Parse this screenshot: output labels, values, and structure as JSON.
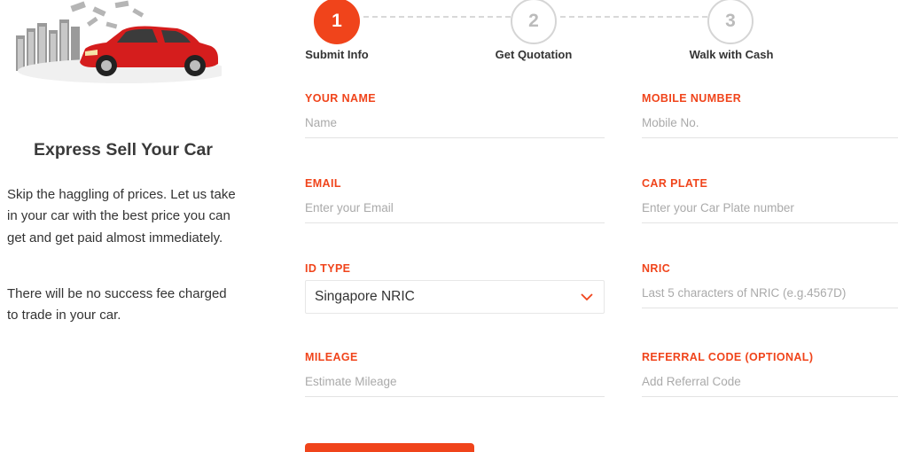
{
  "left_panel": {
    "title": "Express Sell Your Car",
    "paragraph_1": "Skip the haggling of prices. Let us take in your car with the best price you can get and get paid almost immediately.",
    "paragraph_2": "There will be no success fee charged to trade in your car."
  },
  "stepper": {
    "steps": [
      {
        "number": "1",
        "label": "Submit Info",
        "state": "active"
      },
      {
        "number": "2",
        "label": "Get Quotation",
        "state": "inactive"
      },
      {
        "number": "3",
        "label": "Walk with Cash",
        "state": "inactive"
      }
    ]
  },
  "form": {
    "name": {
      "label": "YOUR NAME",
      "placeholder": "Name",
      "value": ""
    },
    "mobile": {
      "label": "MOBILE NUMBER",
      "placeholder": "Mobile No.",
      "value": ""
    },
    "email": {
      "label": "EMAIL",
      "placeholder": "Enter your Email",
      "value": ""
    },
    "car_plate": {
      "label": "CAR PLATE",
      "placeholder": "Enter your Car Plate number",
      "value": ""
    },
    "id_type": {
      "label": "ID TYPE",
      "selected": "Singapore NRIC"
    },
    "nric": {
      "label": "NRIC",
      "placeholder": "Last 5 characters of NRIC (e.g.4567D)",
      "value": ""
    },
    "mileage": {
      "label": "MILEAGE",
      "placeholder": "Estimate Mileage",
      "value": ""
    },
    "referral": {
      "label": "REFERRAL CODE (OPTIONAL)",
      "placeholder": "Add Referral Code",
      "value": ""
    }
  },
  "icons": {
    "hero": "car-with-money-illustration",
    "select_chevron": "chevron-down-icon"
  },
  "colors": {
    "accent": "#f0441b",
    "inactive_step": "#d5d5d5"
  }
}
